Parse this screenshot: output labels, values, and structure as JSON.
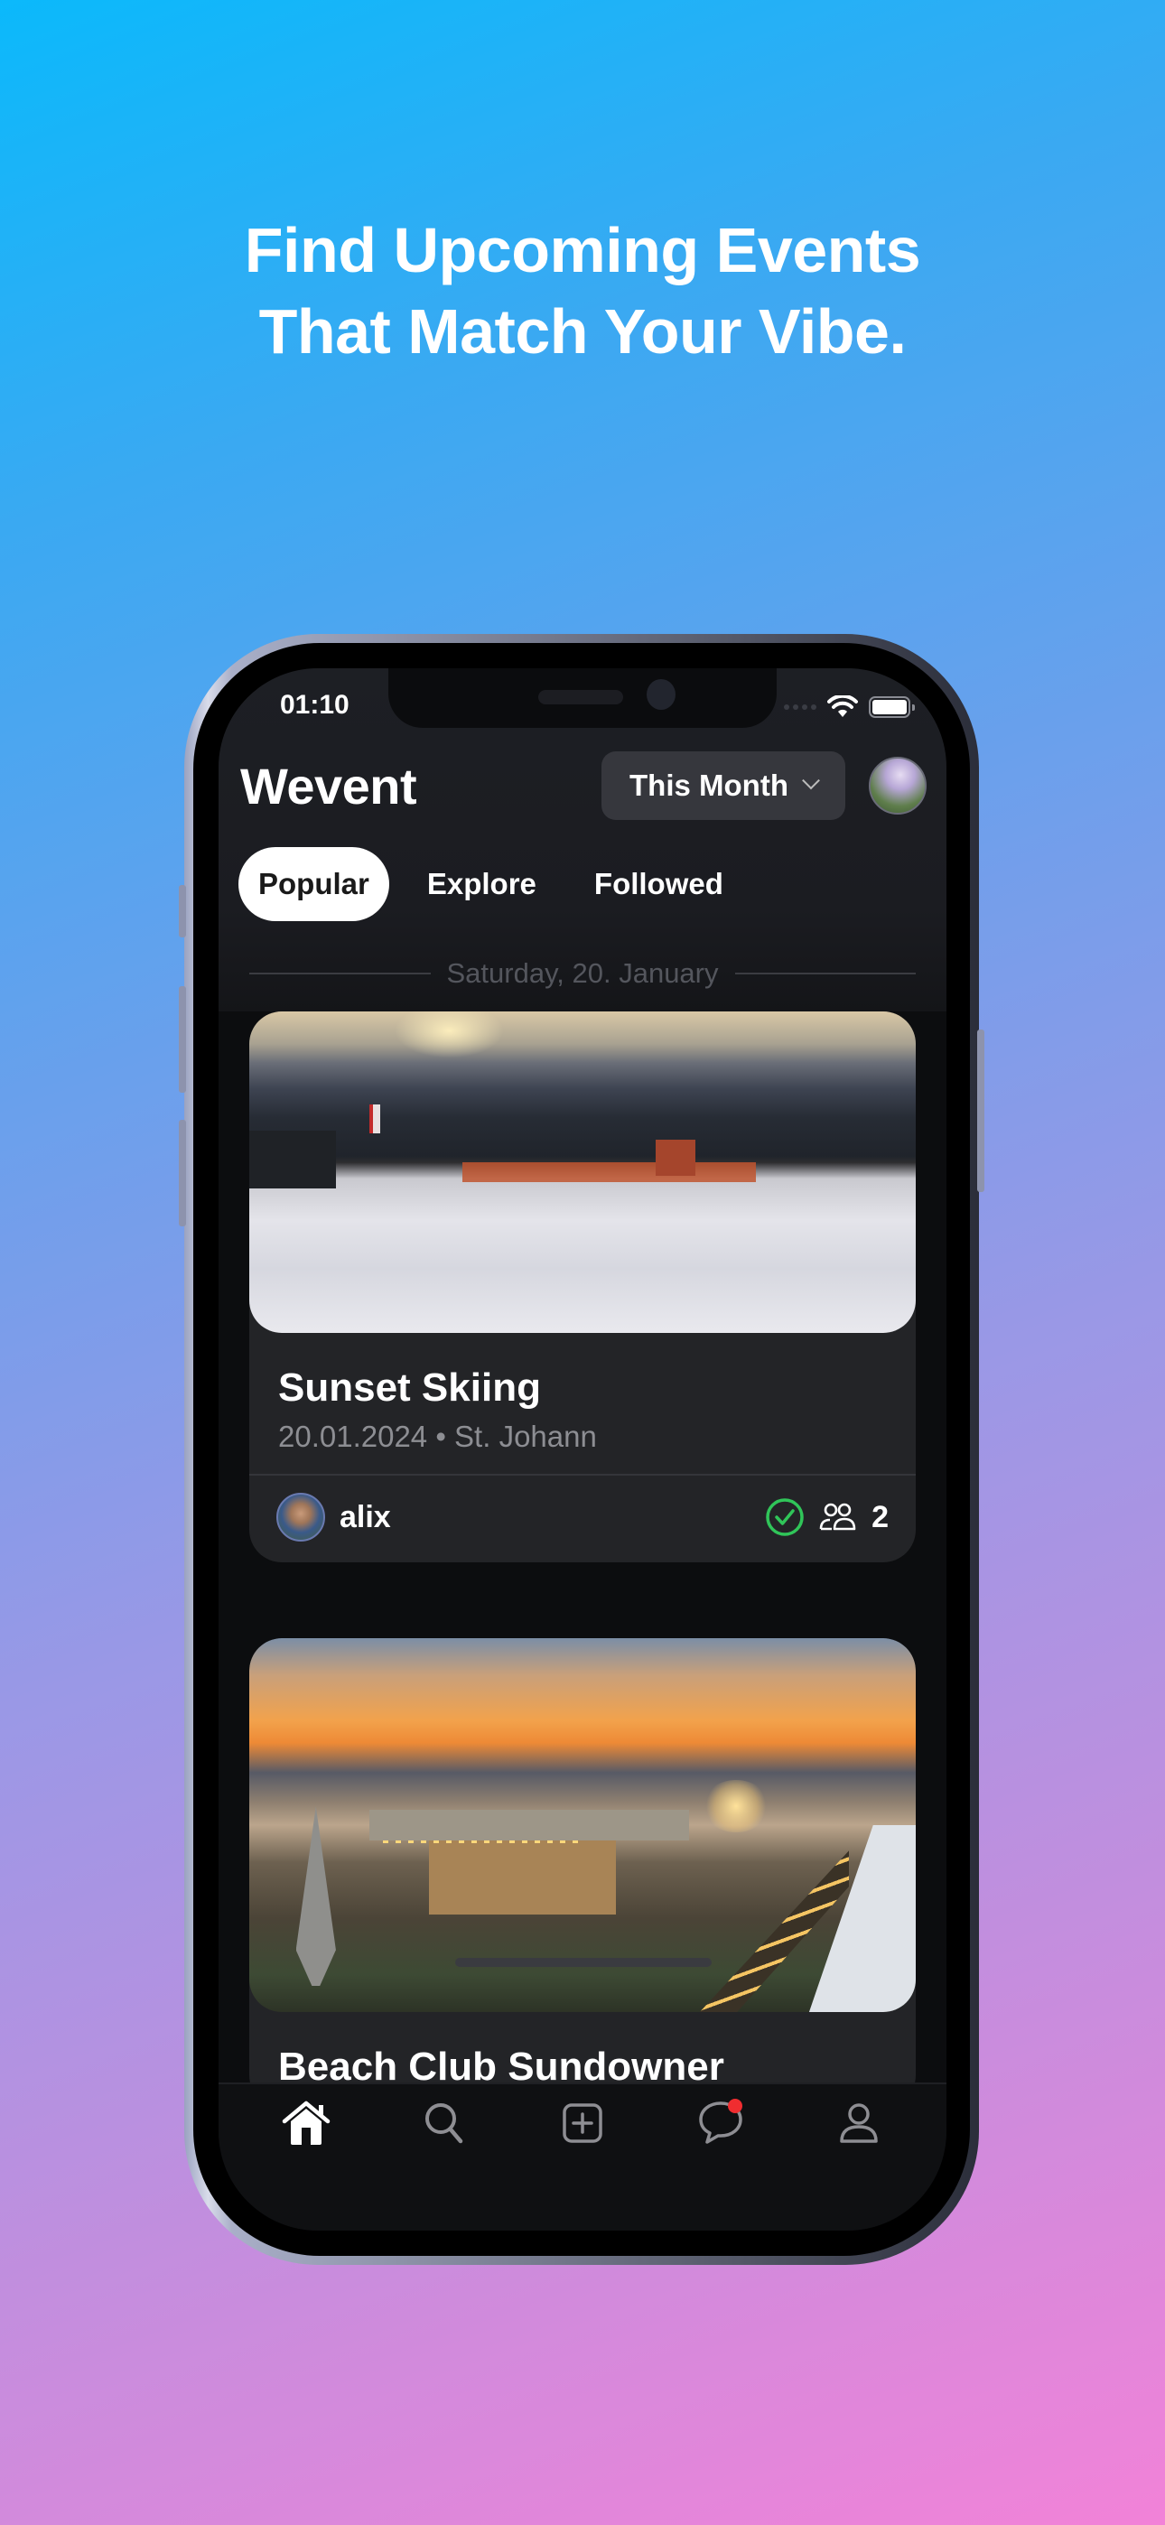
{
  "marketing": {
    "headline_line1": "Find Upcoming Events",
    "headline_line2": "That Match Your Vibe."
  },
  "status_bar": {
    "time": "01:10",
    "icons": [
      "signal-icon",
      "wifi-icon",
      "battery-icon"
    ]
  },
  "header": {
    "app_title": "Wevent",
    "period_select": {
      "value": "This Month",
      "icon": "chevron-down-icon"
    },
    "profile_avatar": "profile-avatar"
  },
  "tabs": [
    {
      "label": "Popular",
      "active": true
    },
    {
      "label": "Explore",
      "active": false
    },
    {
      "label": "Followed",
      "active": false
    }
  ],
  "feed": {
    "date_header": "Saturday, 20. January",
    "events": [
      {
        "title": "Sunset Skiing",
        "date": "20.01.2024",
        "separator": "•",
        "location": "St. Johann",
        "subtitle": "20.01.2024 • St. Johann",
        "host": "alix",
        "attending": true,
        "attendee_count": "2",
        "image": "ski-slope-sunset-photo"
      },
      {
        "title": "Beach Club Sundowner",
        "image": "beach-club-sunset-photo"
      }
    ]
  },
  "tab_bar": {
    "items": [
      {
        "name": "home",
        "icon": "home-icon",
        "active": true
      },
      {
        "name": "search",
        "icon": "search-icon",
        "active": false
      },
      {
        "name": "create",
        "icon": "add-square-icon",
        "active": false
      },
      {
        "name": "messages",
        "icon": "chat-bubble-icon",
        "active": false,
        "badge": true
      },
      {
        "name": "profile",
        "icon": "person-icon",
        "active": false
      }
    ]
  },
  "colors": {
    "accent_green": "#30c559",
    "badge_red": "#f02d30",
    "app_background": "#0c0d0f",
    "card_background": "#232427"
  }
}
